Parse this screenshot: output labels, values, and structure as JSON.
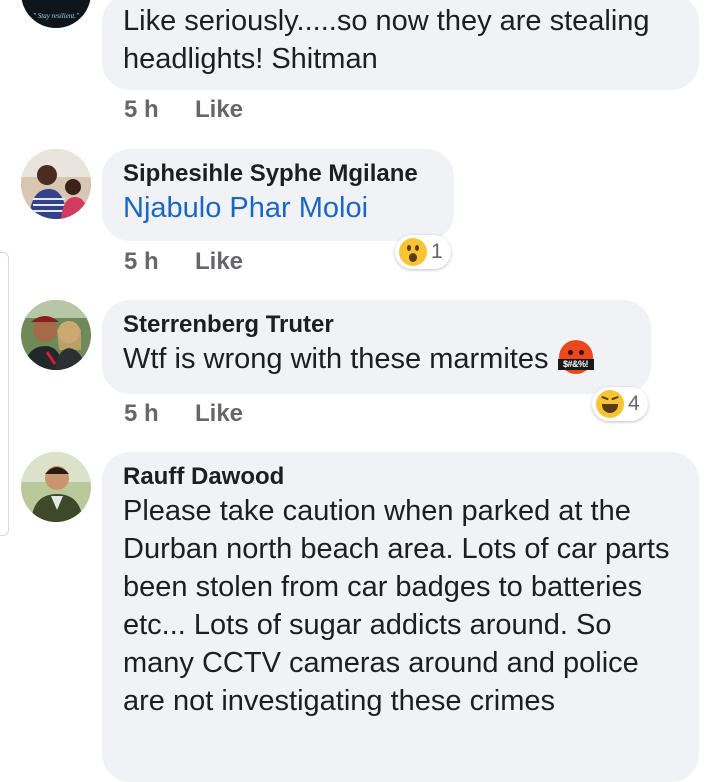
{
  "comments": [
    {
      "author": "",
      "text": "Like seriously.....so now they are stealing headlights! Shitman",
      "time": "5 h",
      "like_label": "Like",
      "avatar_text": "\" Stay resilient.\""
    },
    {
      "author": "Siphesihle Syphe Mgilane",
      "mention": "Njabulo Phar Moloi",
      "time": "5 h",
      "like_label": "Like",
      "reaction": {
        "icon": "wow-emoji",
        "count": "1"
      }
    },
    {
      "author": "Sterrenberg Truter",
      "text": "Wtf is wrong with these marmites",
      "inline_emoji": "angry-cursing-emoji",
      "inline_emoji_text": "$#&%!",
      "time": "5 h",
      "like_label": "Like",
      "reaction": {
        "icon": "haha-emoji",
        "count": "4"
      }
    },
    {
      "author": "Rauff Dawood",
      "text": "Please take caution when parked at the Durban north beach area.  Lots of  car parts been stolen from car badges to batteries etc... Lots of sugar addicts around. So many CCTV cameras around and police are not investigating these crimes"
    }
  ],
  "colors": {
    "bubble": "#f0f2f5",
    "mention": "#1a67c3",
    "meta": "#65676b",
    "text": "#1c1e21"
  }
}
